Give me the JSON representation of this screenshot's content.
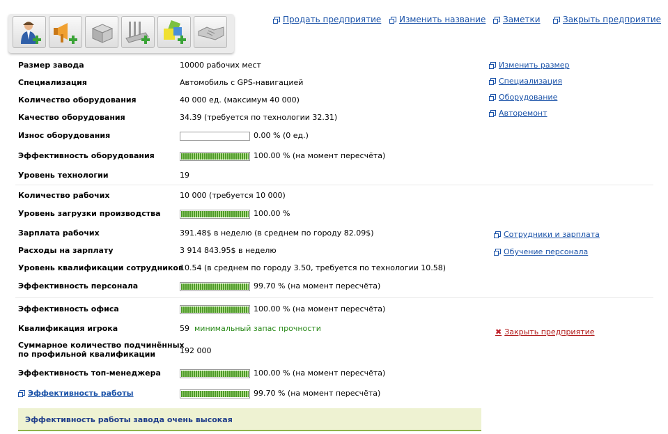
{
  "toolbar": {
    "buttons": [
      {
        "name": "hire-employee-button",
        "icon": "person-plus-icon"
      },
      {
        "name": "advertising-button",
        "icon": "megaphone-plus-icon"
      },
      {
        "name": "warehouse-button",
        "icon": "box-icon"
      },
      {
        "name": "add-equipment-button",
        "icon": "machine-plus-icon"
      },
      {
        "name": "add-cubes-button",
        "icon": "cubes-plus-icon"
      },
      {
        "name": "handshake-button",
        "icon": "handshake-icon"
      }
    ]
  },
  "top_links": {
    "sell": "Продать предприятие",
    "rename": "Изменить название",
    "notes": "Заметки",
    "close": "Закрыть предприятие"
  },
  "side_links": {
    "resize": "Изменить размер",
    "specialization": "Специализация",
    "equipment": "Оборудование",
    "repair": "Авторемонт",
    "staff_salary": "Сотрудники и зарплата",
    "training": "Обучение персонала",
    "close_enterprise": "Закрыть предприятие"
  },
  "rows": {
    "plant_size": {
      "label": "Размер завода",
      "value": "10000 рабочих мест"
    },
    "specialization": {
      "label": "Специализация",
      "value": "Автомобиль с GPS-навигацией"
    },
    "equip_count": {
      "label": "Количество оборудования",
      "value": "40 000 ед. (максимум 40 000)"
    },
    "equip_quality": {
      "label": "Качество оборудования",
      "value": "34.39 (требуется по технологии 32.31)"
    },
    "equip_wear": {
      "label": "Износ оборудования",
      "value": "0.00 % (0 ед.)",
      "level": 0
    },
    "equip_eff": {
      "label": "Эффективность оборудования",
      "value": "100.00 % (на момент пересчёта)",
      "level": 100
    },
    "tech_level": {
      "label": "Уровень технологии",
      "value": "19"
    },
    "workers": {
      "label": "Количество рабочих",
      "value": "10 000 (требуется 10 000)"
    },
    "load": {
      "label": "Уровень загрузки производства",
      "value": "100.00 %",
      "level": 100
    },
    "salary": {
      "label": "Зарплата рабочих",
      "value": "391.48$ в неделю (в среднем по городу 82.09$)"
    },
    "salary_cost": {
      "label": "Расходы на зарплату",
      "value": "3 914 843.95$ в неделю"
    },
    "qualification": {
      "label": "Уровень квалификации сотрудников",
      "value": "10.54 (в среднем по городу 3.50, требуется по технологии 10.58)"
    },
    "staff_eff": {
      "label": "Эффективность персонала",
      "value": "99.70 % (на момент пересчёта)",
      "level": 99.7
    },
    "office_eff": {
      "label": "Эффективность офиса",
      "value": "100.00 % (на момент пересчёта)",
      "level": 100
    },
    "player_qual": {
      "label": "Квалификация игрока",
      "value": "59",
      "note": "минимальный запас прочности"
    },
    "subordinates": {
      "label_line1": "Суммарное количество подчинённых",
      "label_line2": "по профильной квалификации",
      "value": "192 000"
    },
    "topmgr_eff": {
      "label": "Эффективность топ-менеджера",
      "value": "100.00 % (на момент пересчёта)",
      "level": 100
    },
    "work_eff": {
      "label": "Эффективность работы",
      "value": "99.70 % (на момент пересчёта)",
      "level": 99.7
    }
  },
  "summary": "Эффективность работы завода очень высокая"
}
